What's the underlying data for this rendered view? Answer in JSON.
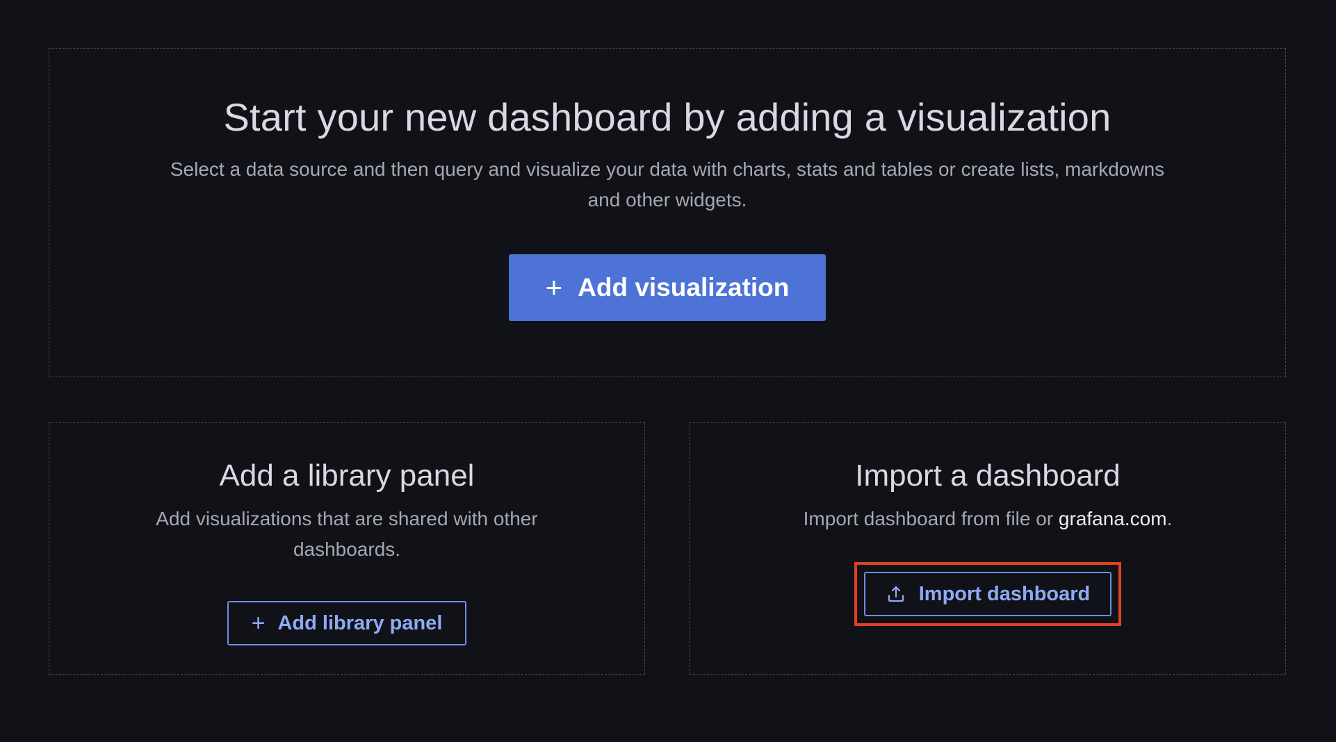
{
  "main_card": {
    "title": "Start your new dashboard by adding a visualization",
    "description": "Select a data source and then query and visualize your data with charts, stats and tables or create lists, markdowns and other widgets.",
    "button_label": "Add visualization",
    "button_icon": "plus-icon",
    "button_color": "#4e73d7"
  },
  "library_card": {
    "title": "Add a library panel",
    "description": "Add visualizations that are shared with other dashboards.",
    "button_label": "Add library panel",
    "button_icon": "plus-icon"
  },
  "import_card": {
    "title": "Import a dashboard",
    "description_prefix": "Import dashboard from file or ",
    "description_link": "grafana.com",
    "description_suffix": ".",
    "button_label": "Import dashboard",
    "button_icon": "upload-icon",
    "highlight_color": "#e2401f"
  },
  "colors": {
    "background": "#111217",
    "secondary_button_border": "#6e8fe6",
    "secondary_button_text": "#8eaaf5"
  }
}
